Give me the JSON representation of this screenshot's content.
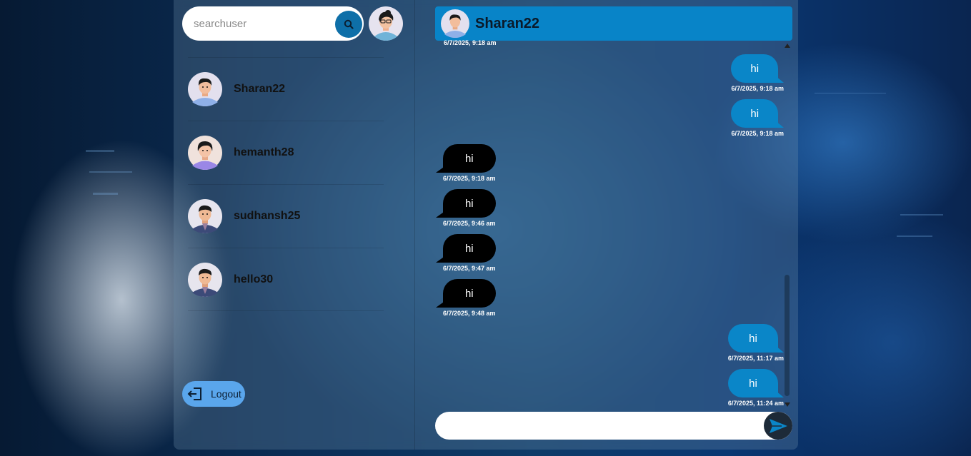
{
  "search": {
    "placeholder": "searchuser",
    "value": ""
  },
  "users": [
    {
      "name": "Sharan22",
      "avatar": "avatar-man-dark-hair"
    },
    {
      "name": "hemanth28",
      "avatar": "avatar-woman-purple"
    },
    {
      "name": "sudhansh25",
      "avatar": "avatar-man-suit"
    },
    {
      "name": "hello30",
      "avatar": "avatar-man-suit"
    }
  ],
  "logout": {
    "label": "Logout"
  },
  "chat": {
    "title": "Sharan22",
    "top_timestamp": "6/7/2025, 9:18 am",
    "messages": [
      {
        "direction": "out",
        "text": "hi",
        "time": "6/7/2025, 9:18 am"
      },
      {
        "direction": "out",
        "text": "hi",
        "time": "6/7/2025, 9:18 am"
      },
      {
        "direction": "in",
        "text": "hi",
        "time": "6/7/2025, 9:18 am"
      },
      {
        "direction": "in",
        "text": "hi",
        "time": "6/7/2025, 9:46 am"
      },
      {
        "direction": "in",
        "text": "hi",
        "time": "6/7/2025, 9:47 am"
      },
      {
        "direction": "in",
        "text": "hi",
        "time": "6/7/2025, 9:48 am"
      },
      {
        "direction": "out",
        "text": "hi",
        "time": "6/7/2025, 11:17 am"
      },
      {
        "direction": "out",
        "text": "hi",
        "time": "6/7/2025, 11:24 am"
      }
    ],
    "compose": {
      "placeholder": "",
      "value": ""
    }
  },
  "colors": {
    "header": "#0884c8",
    "outgoing_bubble": "#0a86c8",
    "incoming_bubble": "#000000",
    "search_button": "#0e6fa8",
    "logout_button": "#5aa6ec",
    "send_button": "#1d2a38"
  },
  "icons": {
    "search": "search-icon",
    "logout": "logout-icon",
    "send": "send-icon"
  }
}
